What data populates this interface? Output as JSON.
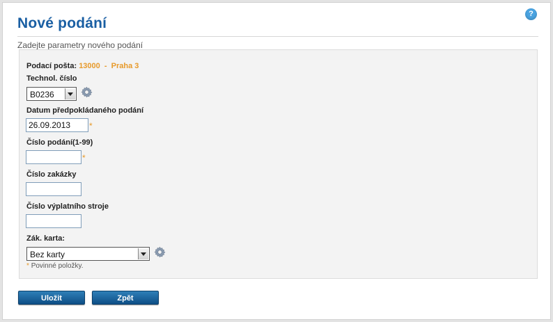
{
  "page": {
    "title": "Nové podání",
    "subtitle": "Zadejte parametry nového podání",
    "help": "?"
  },
  "form": {
    "posta_label": "Podací pošta:",
    "posta_value": "13000  -  Praha 3",
    "technol_label": "Technol. číslo",
    "technol_value": "B0236",
    "datum_label": "Datum předpokládaného podání",
    "datum_value": "26.09.2013",
    "cislo_podani_label": "Číslo podání(1-99)",
    "cislo_podani_value": "",
    "cislo_zakazky_label": "Číslo zakázky",
    "cislo_zakazky_value": "",
    "cislo_stroje_label": "Číslo výplatního stroje",
    "cislo_stroje_value": "",
    "karta_label": "Zák. karta:",
    "karta_value": "Bez karty",
    "required_mark": "*",
    "required_note": "Povinné položky."
  },
  "buttons": {
    "save": "Uložit",
    "back": "Zpět"
  },
  "icons": {
    "settings": "gear-icon",
    "help": "help-icon"
  },
  "colors": {
    "title": "#1a5fa3",
    "accent": "#e79a2b",
    "button": "#0e4f86"
  }
}
